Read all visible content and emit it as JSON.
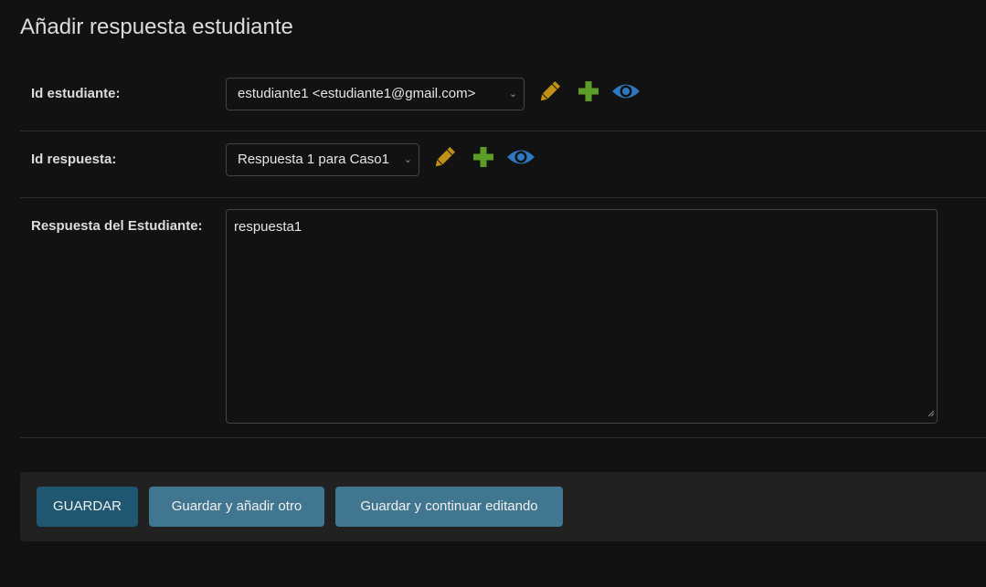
{
  "page": {
    "title": "Añadir respuesta estudiante"
  },
  "colors": {
    "edit": "#c19014",
    "add": "#5c9d28",
    "view": "#2e78c2",
    "primary": "#1f5670",
    "secondary": "#417690"
  },
  "fields": {
    "student": {
      "label": "Id estudiante:",
      "value": "estudiante1 <estudiante1@gmail.com>",
      "icons": [
        "pencil-icon",
        "plus-icon",
        "eye-icon"
      ]
    },
    "answer": {
      "label": "Id respuesta:",
      "value": "Respuesta 1 para Caso1",
      "icons": [
        "pencil-icon",
        "plus-icon",
        "eye-icon"
      ]
    },
    "student_answer": {
      "label": "Respuesta del Estudiante:",
      "value": "respuesta1"
    }
  },
  "actions": {
    "save": "GUARDAR",
    "save_add": "Guardar y añadir otro",
    "save_continue": "Guardar y continuar editando"
  }
}
